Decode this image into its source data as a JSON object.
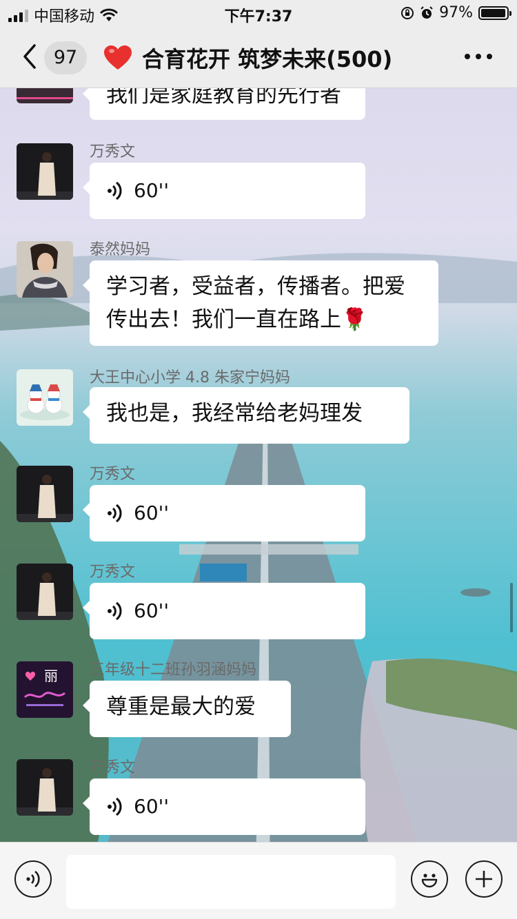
{
  "status_bar": {
    "carrier": "中国移动",
    "time": "下午7:37",
    "battery": "97%",
    "battery_level": 0.97
  },
  "nav": {
    "unread_badge": "97",
    "title": "合育花开 筑梦未来(500)"
  },
  "messages": [
    {
      "sender": "",
      "text": "我们是家庭教育的先行者"
    },
    {
      "sender": "万秀文",
      "voice_duration": "60''"
    },
    {
      "sender": "泰然妈妈",
      "text": "学习者，受益者，传播者。把爱传出去！我们一直在路上🌹"
    },
    {
      "sender": "大王中心小学 4.8 朱家宁妈妈",
      "text": "我也是，我经常给老妈理发"
    },
    {
      "sender": "万秀文",
      "voice_duration": "60''"
    },
    {
      "sender": "万秀文",
      "voice_duration": "60''"
    },
    {
      "sender": "三年级十二班孙羽涵妈妈",
      "text": "尊重是最大的爱"
    },
    {
      "sender": "万秀文",
      "voice_duration": "60''"
    }
  ],
  "avatars": {
    "logo_text": "丽"
  },
  "input": {
    "placeholder": ""
  },
  "colors": {
    "bubble": "#ffffff",
    "bar": "#ededed",
    "heart": "#e8302e"
  }
}
